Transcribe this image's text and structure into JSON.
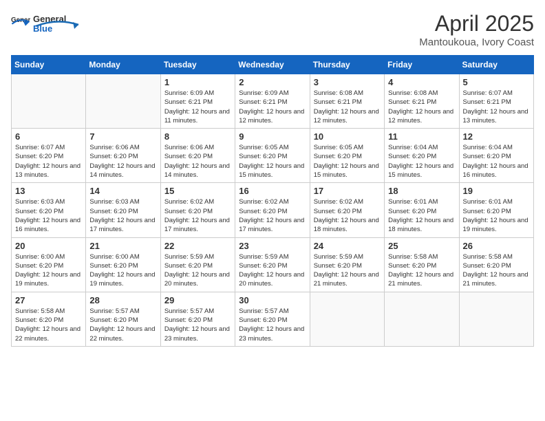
{
  "logo": {
    "general": "General",
    "blue": "Blue"
  },
  "header": {
    "month": "April 2025",
    "location": "Mantoukoua, Ivory Coast"
  },
  "weekdays": [
    "Sunday",
    "Monday",
    "Tuesday",
    "Wednesday",
    "Thursday",
    "Friday",
    "Saturday"
  ],
  "weeks": [
    [
      {
        "day": "",
        "info": ""
      },
      {
        "day": "",
        "info": ""
      },
      {
        "day": "1",
        "info": "Sunrise: 6:09 AM\nSunset: 6:21 PM\nDaylight: 12 hours and 11 minutes."
      },
      {
        "day": "2",
        "info": "Sunrise: 6:09 AM\nSunset: 6:21 PM\nDaylight: 12 hours and 12 minutes."
      },
      {
        "day": "3",
        "info": "Sunrise: 6:08 AM\nSunset: 6:21 PM\nDaylight: 12 hours and 12 minutes."
      },
      {
        "day": "4",
        "info": "Sunrise: 6:08 AM\nSunset: 6:21 PM\nDaylight: 12 hours and 12 minutes."
      },
      {
        "day": "5",
        "info": "Sunrise: 6:07 AM\nSunset: 6:21 PM\nDaylight: 12 hours and 13 minutes."
      }
    ],
    [
      {
        "day": "6",
        "info": "Sunrise: 6:07 AM\nSunset: 6:20 PM\nDaylight: 12 hours and 13 minutes."
      },
      {
        "day": "7",
        "info": "Sunrise: 6:06 AM\nSunset: 6:20 PM\nDaylight: 12 hours and 14 minutes."
      },
      {
        "day": "8",
        "info": "Sunrise: 6:06 AM\nSunset: 6:20 PM\nDaylight: 12 hours and 14 minutes."
      },
      {
        "day": "9",
        "info": "Sunrise: 6:05 AM\nSunset: 6:20 PM\nDaylight: 12 hours and 15 minutes."
      },
      {
        "day": "10",
        "info": "Sunrise: 6:05 AM\nSunset: 6:20 PM\nDaylight: 12 hours and 15 minutes."
      },
      {
        "day": "11",
        "info": "Sunrise: 6:04 AM\nSunset: 6:20 PM\nDaylight: 12 hours and 15 minutes."
      },
      {
        "day": "12",
        "info": "Sunrise: 6:04 AM\nSunset: 6:20 PM\nDaylight: 12 hours and 16 minutes."
      }
    ],
    [
      {
        "day": "13",
        "info": "Sunrise: 6:03 AM\nSunset: 6:20 PM\nDaylight: 12 hours and 16 minutes."
      },
      {
        "day": "14",
        "info": "Sunrise: 6:03 AM\nSunset: 6:20 PM\nDaylight: 12 hours and 17 minutes."
      },
      {
        "day": "15",
        "info": "Sunrise: 6:02 AM\nSunset: 6:20 PM\nDaylight: 12 hours and 17 minutes."
      },
      {
        "day": "16",
        "info": "Sunrise: 6:02 AM\nSunset: 6:20 PM\nDaylight: 12 hours and 17 minutes."
      },
      {
        "day": "17",
        "info": "Sunrise: 6:02 AM\nSunset: 6:20 PM\nDaylight: 12 hours and 18 minutes."
      },
      {
        "day": "18",
        "info": "Sunrise: 6:01 AM\nSunset: 6:20 PM\nDaylight: 12 hours and 18 minutes."
      },
      {
        "day": "19",
        "info": "Sunrise: 6:01 AM\nSunset: 6:20 PM\nDaylight: 12 hours and 19 minutes."
      }
    ],
    [
      {
        "day": "20",
        "info": "Sunrise: 6:00 AM\nSunset: 6:20 PM\nDaylight: 12 hours and 19 minutes."
      },
      {
        "day": "21",
        "info": "Sunrise: 6:00 AM\nSunset: 6:20 PM\nDaylight: 12 hours and 19 minutes."
      },
      {
        "day": "22",
        "info": "Sunrise: 5:59 AM\nSunset: 6:20 PM\nDaylight: 12 hours and 20 minutes."
      },
      {
        "day": "23",
        "info": "Sunrise: 5:59 AM\nSunset: 6:20 PM\nDaylight: 12 hours and 20 minutes."
      },
      {
        "day": "24",
        "info": "Sunrise: 5:59 AM\nSunset: 6:20 PM\nDaylight: 12 hours and 21 minutes."
      },
      {
        "day": "25",
        "info": "Sunrise: 5:58 AM\nSunset: 6:20 PM\nDaylight: 12 hours and 21 minutes."
      },
      {
        "day": "26",
        "info": "Sunrise: 5:58 AM\nSunset: 6:20 PM\nDaylight: 12 hours and 21 minutes."
      }
    ],
    [
      {
        "day": "27",
        "info": "Sunrise: 5:58 AM\nSunset: 6:20 PM\nDaylight: 12 hours and 22 minutes."
      },
      {
        "day": "28",
        "info": "Sunrise: 5:57 AM\nSunset: 6:20 PM\nDaylight: 12 hours and 22 minutes."
      },
      {
        "day": "29",
        "info": "Sunrise: 5:57 AM\nSunset: 6:20 PM\nDaylight: 12 hours and 23 minutes."
      },
      {
        "day": "30",
        "info": "Sunrise: 5:57 AM\nSunset: 6:20 PM\nDaylight: 12 hours and 23 minutes."
      },
      {
        "day": "",
        "info": ""
      },
      {
        "day": "",
        "info": ""
      },
      {
        "day": "",
        "info": ""
      }
    ]
  ]
}
